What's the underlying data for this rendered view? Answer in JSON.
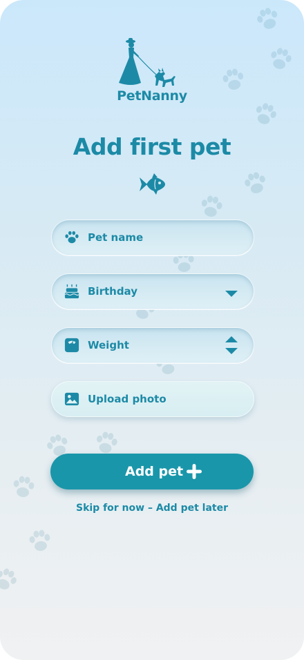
{
  "app": {
    "logo_text": "PetNanny"
  },
  "header": {
    "title": "Add first pet"
  },
  "form": {
    "pet_name": {
      "label": "Pet name",
      "icon": "paw-icon"
    },
    "birthday": {
      "label": "Birthday",
      "icon": "cake-icon",
      "trail_icon": "caret-down-icon"
    },
    "weight": {
      "label": "Weight",
      "icon": "scale-icon",
      "trail_icon": "stepper-icon"
    },
    "photo": {
      "label": "Upload photo",
      "icon": "image-icon"
    }
  },
  "actions": {
    "add_pet_label": "Add pet",
    "skip_label": "Skip for now – Add pet later"
  },
  "colors": {
    "accent": "#1c8aa6",
    "button": "#1a96aa",
    "background_top": "#cbe8fb",
    "background_bottom": "#f0f1f2"
  }
}
